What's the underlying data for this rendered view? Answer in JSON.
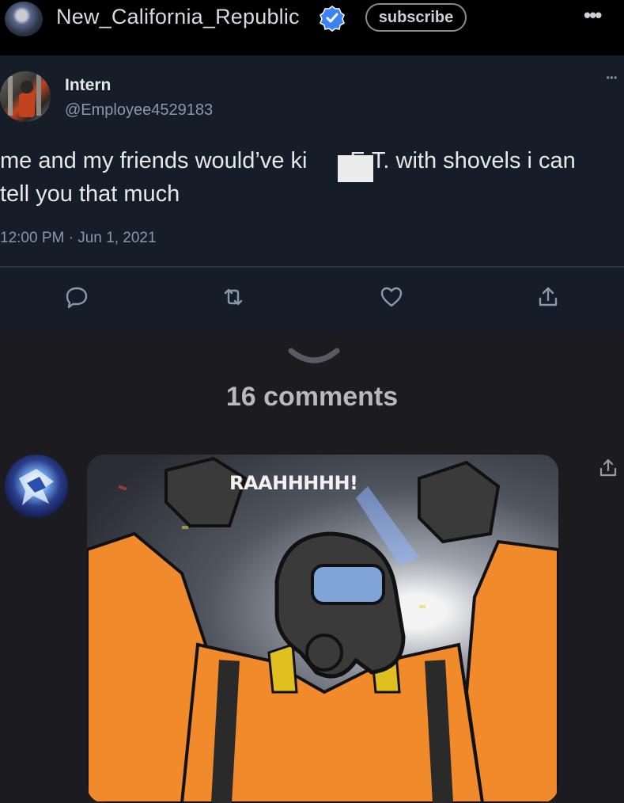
{
  "header": {
    "community_name": "New_California_Republic",
    "subscribe_label": "subscribe",
    "more_label": "•••",
    "verified_color": "#3b82f6"
  },
  "tweet": {
    "display_name": "Intern",
    "handle": "@Employee4529183",
    "more_label": "···",
    "text_part1": "me and my friends would’ve ki",
    "text_part2": " E.T. with shovels i can tell you that much",
    "timestamp": "12:00 PM · Jun 1, 2021",
    "actions": [
      "reply-icon",
      "retweet-icon",
      "like-icon",
      "share-icon"
    ]
  },
  "comments": {
    "count_label": "16 comments",
    "first_comment": {
      "image_caption": "RAAHHHHH!"
    }
  }
}
